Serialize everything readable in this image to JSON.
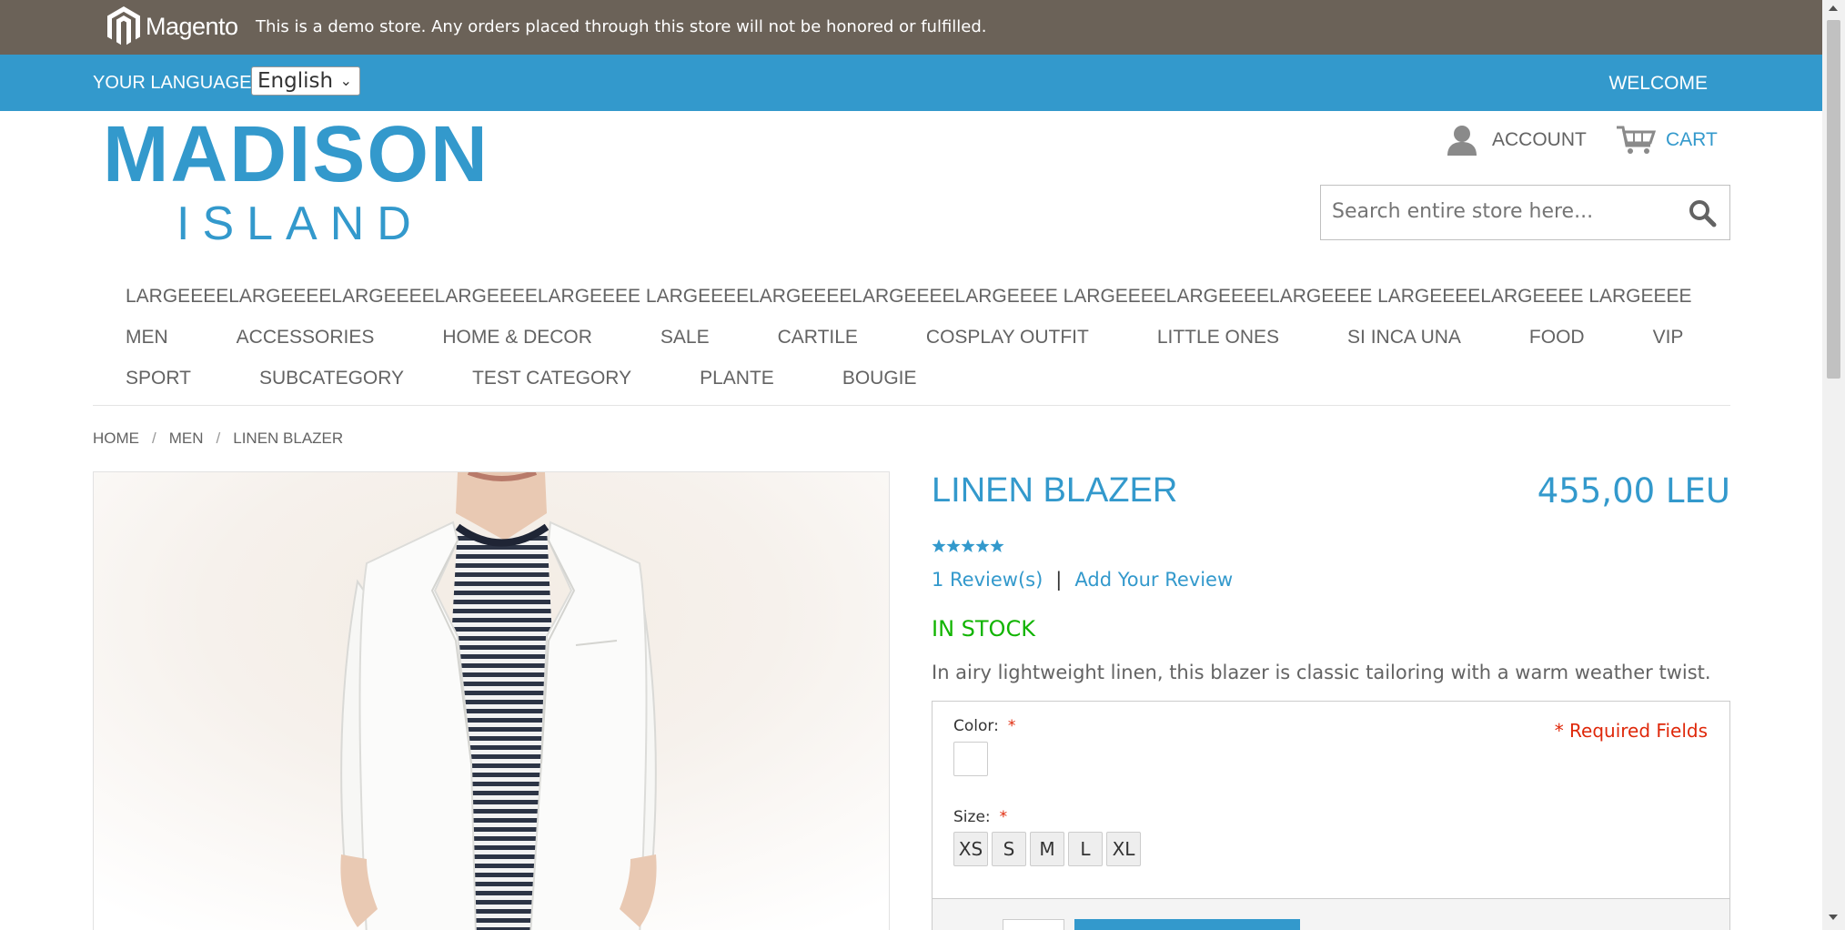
{
  "demo_notice": {
    "brand": "Magento",
    "text": "This is a demo store. Any orders placed through this store will not be honored or fulfilled."
  },
  "language_bar": {
    "label": "YOUR LANGUAGE:",
    "selected_language": "English",
    "welcome": "WELCOME"
  },
  "header": {
    "logo_line1": "MADISON",
    "logo_line2": "ISLAND",
    "account_label": "ACCOUNT",
    "cart_label": "CART",
    "search_placeholder": "Search entire store here..."
  },
  "navigation": {
    "long_item": "LARGEEEELARGEEEELARGEEEELARGEEEELARGEEEE LARGEEEELARGEEEELARGEEEELARGEEEE LARGEEEELARGEEEELARGEEEE LARGEEEELARGEEEE LARGEEEE",
    "row1": [
      "MEN",
      "ACCESSORIES",
      "HOME & DECOR",
      "SALE",
      "CARTILE",
      "COSPLAY OUTFIT",
      "LITTLE ONES",
      "SI INCA UNA",
      "FOOD",
      "VIP"
    ],
    "row2": [
      "SPORT",
      "SUBCATEGORY",
      "TEST CATEGORY",
      "PLANTE",
      "BOUGIE"
    ]
  },
  "breadcrumb": [
    "HOME",
    "MEN",
    "LINEN BLAZER"
  ],
  "breadcrumb_separator": "/",
  "product": {
    "name": "LINEN BLAZER",
    "price": "455,00 LEU",
    "rating_stars": 5,
    "reviews_link": "1 Review(s)",
    "reviews_separator": "|",
    "add_review_link": "Add Your Review",
    "stock_status": "IN STOCK",
    "description": "In airy lightweight linen, this blazer is classic tailoring with a warm weather twist."
  },
  "options": {
    "color_label": "Color:",
    "size_label": "Size:",
    "required_star": "*",
    "required_note": "* Required Fields",
    "sizes": [
      "XS",
      "S",
      "M",
      "L",
      "XL"
    ]
  },
  "colors": {
    "accent": "#3399cc",
    "demo_bar": "#6b6258",
    "in_stock": "#11b400",
    "required": "#df280a"
  }
}
